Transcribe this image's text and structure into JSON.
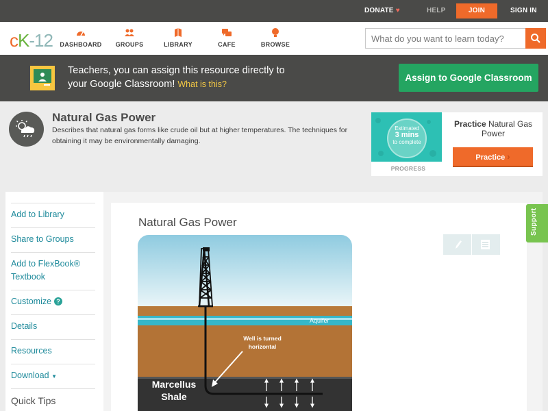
{
  "topbar": {
    "donate": "DONATE",
    "help": "HELP",
    "join": "JOIN",
    "signin": "SIGN IN"
  },
  "nav": {
    "logo": {
      "c": "c",
      "k": "K",
      "n": "-12"
    },
    "items": [
      {
        "label": "DASHBOARD",
        "icon": "dashboard-icon"
      },
      {
        "label": "GROUPS",
        "icon": "groups-icon"
      },
      {
        "label": "LIBRARY",
        "icon": "library-icon"
      },
      {
        "label": "CAFE",
        "icon": "cafe-icon"
      },
      {
        "label": "BROWSE",
        "icon": "browse-icon"
      }
    ],
    "search_placeholder": "What do you want to learn today?"
  },
  "banner": {
    "text": "Teachers, you can assign this resource directly to your Google Classroom!",
    "what": "What is this?",
    "assign": "Assign to Google Classroom"
  },
  "concept": {
    "title": "Natural Gas Power",
    "description": "Describes that natural gas forms like crude oil but at higher temperatures. The techniques for obtaining it may be environmentally damaging."
  },
  "practice": {
    "estimated_line1": "Estimated",
    "estimated_line2": "3 mins",
    "estimated_line3": "to complete",
    "progress": "PROGRESS",
    "title_bold": "Practice",
    "title_rest": "Natural Gas Power",
    "button": "Practice"
  },
  "sidebar": {
    "items": [
      "Add to Library",
      "Share to Groups",
      "Add to FlexBook® Textbook",
      "Customize",
      "Details",
      "Resources",
      "Download"
    ],
    "quick_tips": "Quick Tips"
  },
  "content": {
    "title": "Natural Gas Power"
  },
  "diagram": {
    "aquifer": "Aquifer",
    "well_note": "Well is turned horizontal",
    "shale_line1": "Marcellus",
    "shale_line2": "Shale"
  },
  "support": "Support",
  "colors": {
    "accent": "#ef6a2a",
    "teal_link": "#1e8a9b",
    "green": "#24a561",
    "dark_bar": "#4a4a48"
  }
}
